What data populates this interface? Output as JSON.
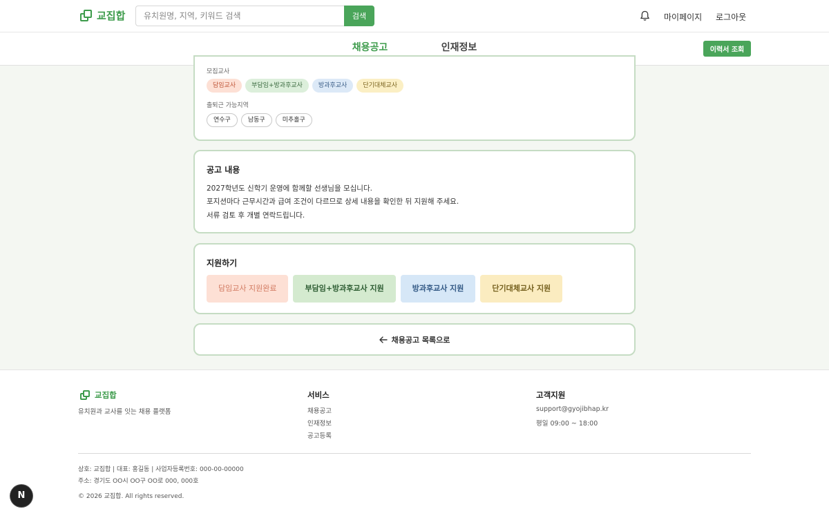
{
  "header": {
    "logo_text": "교집합",
    "search_placeholder": "유치원명, 지역, 키워드 검색",
    "search_button": "검색",
    "mypage": "마이페이지",
    "logout": "로그아웃"
  },
  "tabs": [
    {
      "label": "채용공고",
      "active": true
    },
    {
      "label": "인재정보",
      "active": false
    }
  ],
  "resume_button": "이력서 조회",
  "detail": {
    "teacher_label": "모집교사",
    "teacher_types": [
      "담임교사",
      "부담임+방과후교사",
      "방과후교사",
      "단기대체교사"
    ],
    "region_label": "출퇴근 가능지역",
    "regions": [
      "연수구",
      "남동구",
      "미추홀구"
    ]
  },
  "content": {
    "title": "공고 내용",
    "lines": [
      "2027학년도 신학기 운영에 함께할 선생님을 모십니다.",
      "포지션마다 근무시간과 급여 조건이 다르므로 상세 내용을 확인한 뒤 지원해 주세요.",
      "서류 검토 후 개별 연락드립니다."
    ]
  },
  "apply": {
    "title": "지원하기",
    "buttons": [
      "담임교사 지원완료",
      "부담임+방과후교사 지원",
      "방과후교사 지원",
      "단기대체교사 지원"
    ]
  },
  "back_label": "채용공고 목록으로",
  "footer": {
    "logo_text": "교집합",
    "tagline": "유치원과 교사를 잇는 채용 플랫폼",
    "service_title": "서비스",
    "service_links": [
      "채용공고",
      "인재정보",
      "공고등록"
    ],
    "support_title": "고객지원",
    "support_email": "support@gyojibhap.kr",
    "support_hours": "평일 09:00 ~ 18:00",
    "company_info": "상호: 교집합 | 대표: 홍길동 | 사업자등록번호: 000-00-00000",
    "address": "주소: 경기도 OO시 OO구 OO로 000, 000호",
    "copyright": "© 2026 교집합. All rights reserved."
  },
  "fab_label": "N",
  "colors": {
    "accent": "#4aa55a",
    "accent_dark": "#3d9b4b"
  }
}
